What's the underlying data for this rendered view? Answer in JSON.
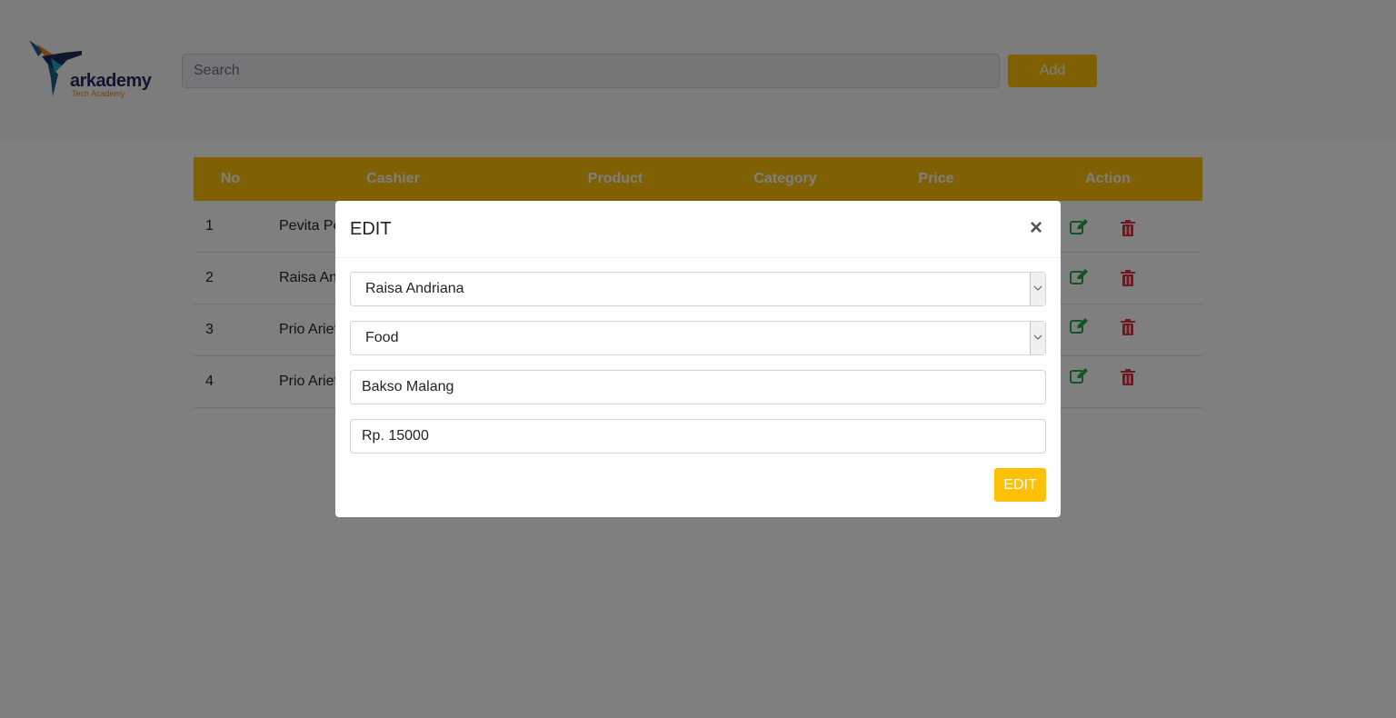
{
  "header": {
    "logo_text": "arkademy",
    "logo_subtext": "Tech Academy",
    "search_placeholder": "Search",
    "add_label": "Add"
  },
  "table": {
    "columns": [
      "No",
      "Cashier",
      "Product",
      "Category",
      "Price",
      "Action"
    ],
    "rows": [
      {
        "no": "1",
        "cashier": "Pevita Pea"
      },
      {
        "no": "2",
        "cashier": "Raisa And"
      },
      {
        "no": "3",
        "cashier": "Prio Arief"
      },
      {
        "no": "4",
        "cashier": "Prio Arief"
      }
    ]
  },
  "modal": {
    "title": "EDIT",
    "close_symbol": "×",
    "cashier_value": "Raisa Andriana",
    "category_value": "Food",
    "product_value": "Bakso Malang",
    "price_value": "Rp. 15000",
    "submit_label": "EDIT"
  },
  "colors": {
    "accent": "#ffc107",
    "edit_icon": "#28a745",
    "delete_icon": "#dc3545"
  }
}
